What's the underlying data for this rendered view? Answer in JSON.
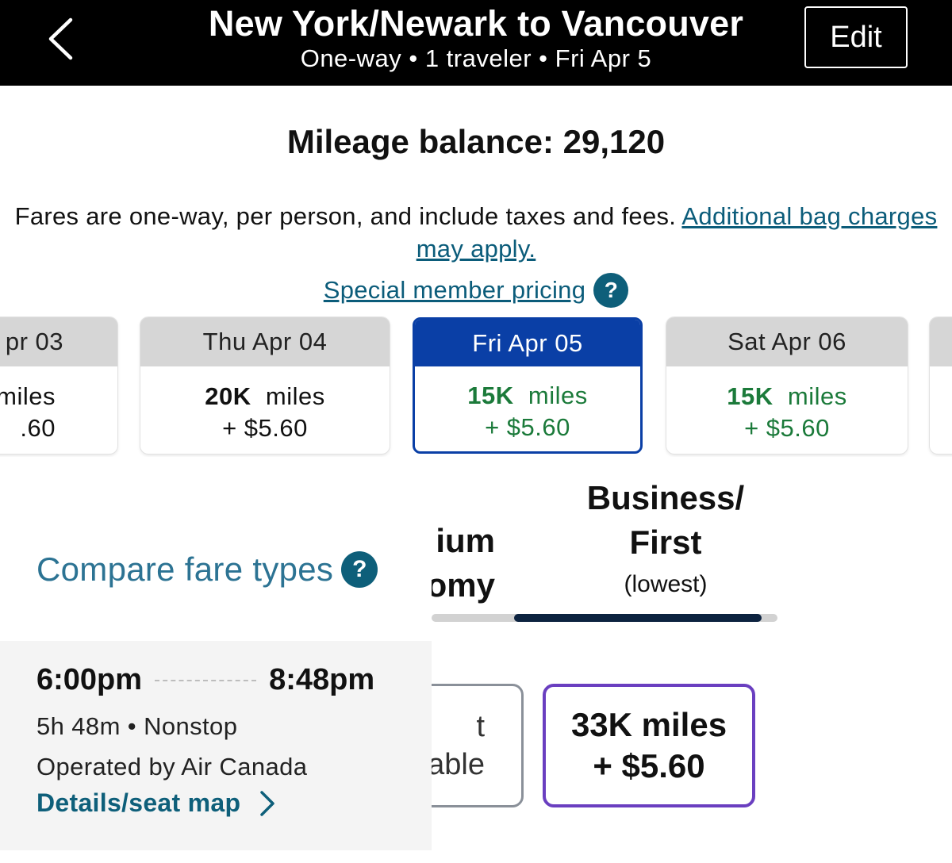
{
  "header": {
    "title": "New York/Newark to Vancouver",
    "subtitle": "One-way • 1 traveler • Fri Apr 5",
    "edit_label": "Edit"
  },
  "mileage_balance": "Mileage balance: 29,120",
  "fares_note": {
    "text": "Fares are one-way, per person, and include taxes and fees. ",
    "link": "Additional bag charges may apply."
  },
  "special_pricing": {
    "label": "Special member pricing",
    "help_icon": "?"
  },
  "dates": [
    {
      "label": "pr 03",
      "miles": "",
      "miles_unit": "miles",
      "price": ".60",
      "state": "partial"
    },
    {
      "label": "Thu Apr 04",
      "miles": "20K",
      "miles_unit": "miles",
      "price": "+ $5.60",
      "state": "normal"
    },
    {
      "label": "Fri Apr 05",
      "miles": "15K",
      "miles_unit": "miles",
      "price": "+ $5.60",
      "state": "selected"
    },
    {
      "label": "Sat Apr 06",
      "miles": "15K",
      "miles_unit": "miles",
      "price": "+ $5.60",
      "state": "green"
    }
  ],
  "compare": {
    "label": "Compare fare types",
    "help_icon": "?"
  },
  "cabins": {
    "premium": {
      "line1": "ium",
      "line2": "omy"
    },
    "business": {
      "line1": "Business/",
      "line2": "First",
      "sub": "(lowest)"
    }
  },
  "flight": {
    "depart": "6:00pm",
    "arrive": "8:48pm",
    "duration": "5h 48m • Nonstop",
    "operator": "Operated by Air Canada",
    "details_link": "Details/seat map",
    "premium_fare": {
      "line1": "t",
      "line2": "able"
    },
    "business_fare": {
      "line1": "33K miles",
      "line2": "+ $5.60"
    }
  },
  "colors": {
    "header_bg": "#000000",
    "link": "#0b5c7a",
    "selected_date": "#0a3fa6",
    "green_price": "#1b7a3a",
    "fare_border": "#6a3fc0",
    "tab_active": "#0d2340"
  }
}
